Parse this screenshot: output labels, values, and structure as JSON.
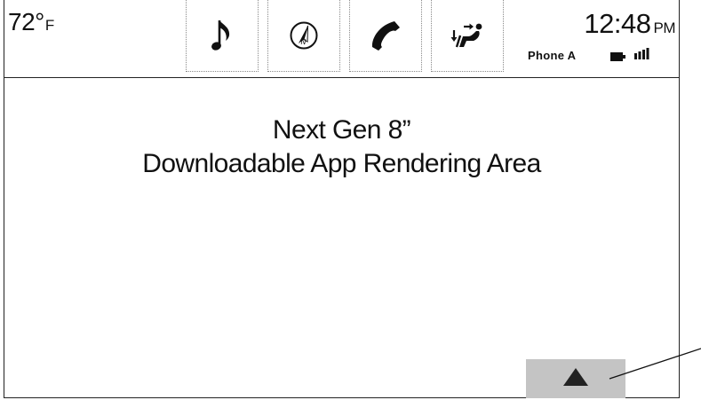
{
  "status_bar": {
    "temperature_value": "72°",
    "temperature_unit": "F",
    "clock_time": "12:48",
    "clock_ampm": "PM",
    "phone_name": "Phone A"
  },
  "tiles": [
    {
      "icon": "music-note-icon"
    },
    {
      "icon": "navigation-compass-icon"
    },
    {
      "icon": "phone-handset-icon"
    },
    {
      "icon": "climate-seat-airflow-icon"
    }
  ],
  "content": {
    "line1": "Next Gen 8”",
    "line2": "Downloadable App Rendering Area"
  },
  "colors": {
    "foreground": "#111111",
    "tile_border": "#8a8a8a",
    "up_button_bg": "#c4c4c4",
    "background": "#ffffff"
  }
}
